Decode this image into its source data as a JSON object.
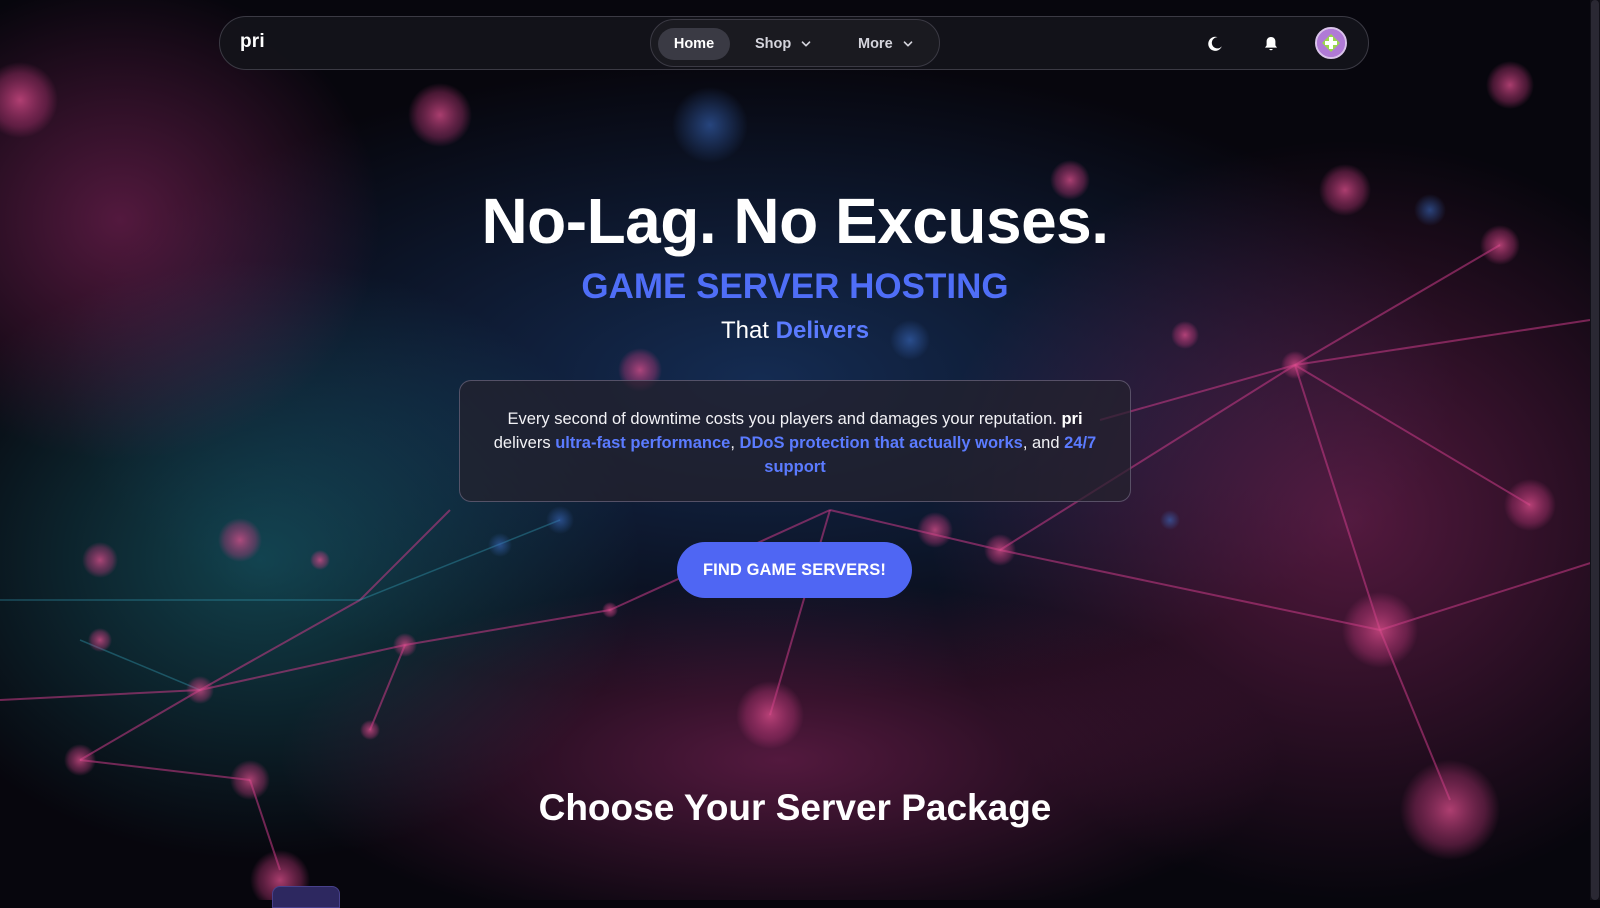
{
  "navbar": {
    "brand": "pri",
    "items": [
      {
        "label": "Home",
        "active": true
      },
      {
        "label": "Shop",
        "has_dropdown": true
      },
      {
        "label": "More",
        "has_dropdown": true
      }
    ],
    "icons": [
      "moon-icon",
      "bell-icon",
      "avatar"
    ]
  },
  "hero": {
    "title": "No-Lag. No Excuses.",
    "subtitle": "GAME SERVER HOSTING",
    "tagline_prefix": "That",
    "tagline_highlight": "Delivers",
    "description": {
      "part1": "Every second of downtime costs you players and damages your reputation.",
      "brand": "pri",
      "part2": "delivers",
      "link1": "ultra-fast performance",
      "sep1": ",",
      "link2": "DDoS protection that actually works",
      "sep2": ", and",
      "link3": "24/7 support"
    },
    "cta_label": "FIND GAME SERVERS!"
  },
  "packages": {
    "title": "Choose Your Server Package"
  },
  "colors": {
    "accent": "#4f6ef7",
    "button": "#4f66f3",
    "background": "#07060d"
  }
}
